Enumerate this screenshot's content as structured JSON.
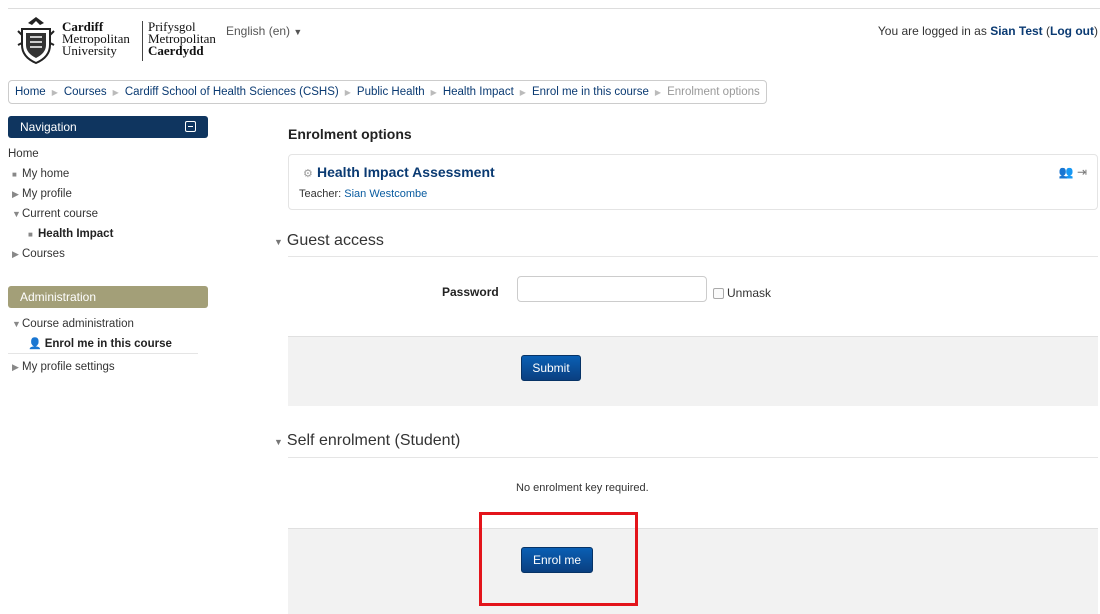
{
  "header": {
    "logo_en": [
      "Cardiff",
      "Metropolitan",
      "University"
    ],
    "logo_cy": [
      "Prifysgol",
      "Metropolitan",
      "Caerdydd"
    ],
    "language": "English (en)",
    "login_prefix": "You are logged in as",
    "user_name": "Sian Test",
    "logout_label": "Log out"
  },
  "breadcrumb": [
    "Home",
    "Courses",
    "Cardiff School of Health Sciences (CSHS)",
    "Public Health",
    "Health Impact",
    "Enrol me in this course",
    "Enrolment options"
  ],
  "navigation": {
    "title": "Navigation",
    "items": [
      "Home",
      "My home",
      "My profile",
      "Current course",
      "Health Impact",
      "Courses"
    ]
  },
  "administration": {
    "title": "Administration",
    "items": [
      "Course administration",
      "Enrol me in this course",
      "My profile settings"
    ]
  },
  "main": {
    "title": "Enrolment options",
    "course_name": "Health Impact Assessment",
    "teacher_label": "Teacher:",
    "teacher_name": "Sian Westcombe",
    "guest": {
      "heading": "Guest access",
      "password_label": "Password",
      "password_value": "",
      "unmask_label": "Unmask",
      "submit_label": "Submit"
    },
    "self": {
      "heading": "Self enrolment (Student)",
      "note": "No enrolment key required.",
      "enrol_label": "Enrol me"
    }
  },
  "colors": {
    "nav_header": "#0f355f",
    "admin_header": "#a39f78",
    "link": "#0a3a72",
    "button": "#0a5fb4",
    "highlight": "#e3141b"
  }
}
